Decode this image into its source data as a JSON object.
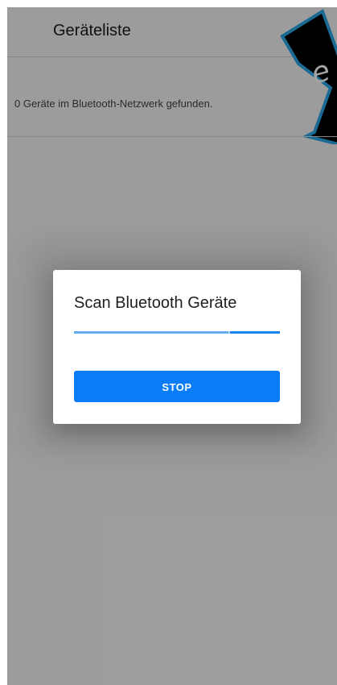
{
  "header": {
    "title": "Geräteliste"
  },
  "status": {
    "text": "0 Geräte im Bluetooth-Netzwerk gefunden."
  },
  "dialog": {
    "title": "Scan Bluetooth Geräte",
    "progress_fraction": 0.75,
    "stop_label": "STOP"
  },
  "colors": {
    "accent": "#0a7cf7",
    "logo_border": "#2aa7e8",
    "logo_fill": "#000000"
  },
  "icons": {
    "corner_logo": "brand-logo-icon"
  }
}
